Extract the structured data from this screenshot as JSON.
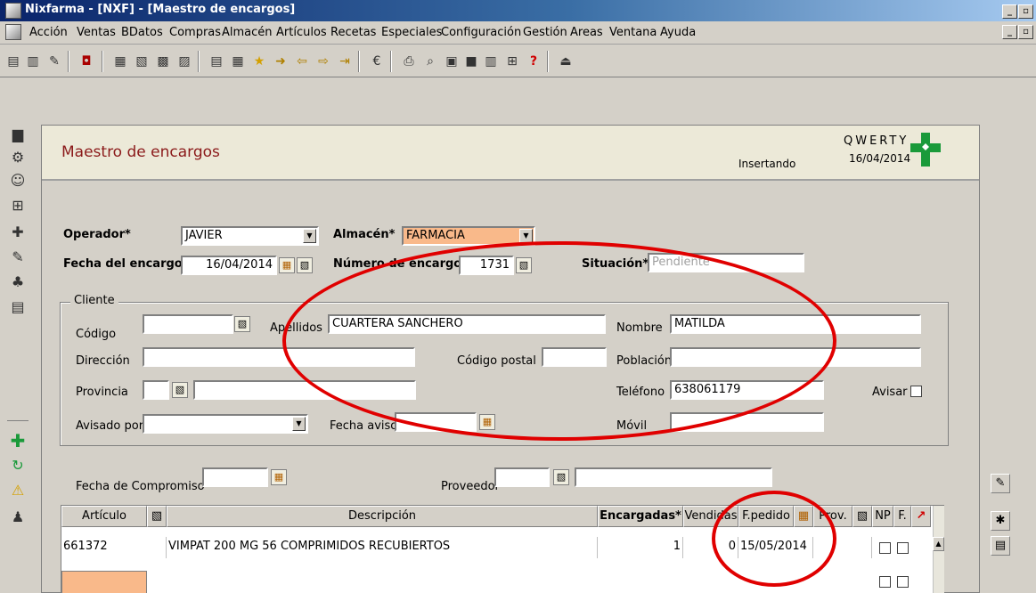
{
  "window": {
    "title": "Nixfarma - [NXF] - [Maestro de encargos]"
  },
  "menu": [
    "Acción",
    "Ventas",
    "BDatos",
    "Compras",
    "Almacén",
    "Artículos",
    "Recetas",
    "Especiales",
    "Configuración",
    "Gestión",
    "Areas",
    "Ventana",
    "Ayuda"
  ],
  "header": {
    "title": "Maestro de encargos",
    "mode": "Insertando",
    "company": "QWERTY",
    "date": "16/04/2014"
  },
  "form": {
    "operador_label": "Operador*",
    "operador_value": "JAVIER",
    "almacen_label": "Almacén*",
    "almacen_value": "FARMACIA",
    "fecha_label": "Fecha del encargo*",
    "fecha_value": "16/04/2014",
    "numero_label": "Número de encargo*",
    "numero_value": "1731",
    "situacion_label": "Situación*",
    "situacion_value": "Pendiente"
  },
  "cliente": {
    "group_label": "Cliente",
    "codigo_label": "Código",
    "codigo_value": "",
    "apellidos_label": "Apellidos",
    "apellidos_value": "CUARTERA SANCHERO",
    "nombre_label": "Nombre",
    "nombre_value": "MATILDA",
    "direccion_label": "Dirección",
    "direccion_value": "",
    "cp_label": "Código postal",
    "cp_value": "",
    "poblacion_label": "Población",
    "poblacion_value": "",
    "provincia_label": "Provincia",
    "provincia_value": "",
    "telefono_label": "Teléfono",
    "telefono_value": "638061179",
    "avisar_label": "Avisar",
    "avisado_label": "Avisado por",
    "avisado_value": "",
    "fecha_aviso_label": "Fecha aviso",
    "fecha_aviso_value": "",
    "movil_label": "Móvil",
    "movil_value": ""
  },
  "compromiso": {
    "label": "Fecha de Compromiso",
    "value": "",
    "proveedor_label": "Proveedor",
    "proveedor_code": "",
    "proveedor_name": ""
  },
  "grid": {
    "columns": {
      "articulo": "Artículo",
      "descripcion": "Descripción",
      "encargadas": "Encargadas*",
      "vendidas": "Vendidas",
      "fpedido": "F.pedido",
      "prov": "Prov.",
      "np": "NP",
      "f": "F."
    },
    "rows": [
      {
        "articulo": "661372",
        "descripcion": "VIMPAT 200 MG 56 COMPRIMIDOS RECUBIERTOS",
        "encargadas": "1",
        "vendidas": "0",
        "fpedido": "15/05/2014"
      }
    ]
  },
  "colors": {
    "annotation": "#e00000",
    "highlight_field": "#f9b98a",
    "logo": "#1a9a3a"
  }
}
